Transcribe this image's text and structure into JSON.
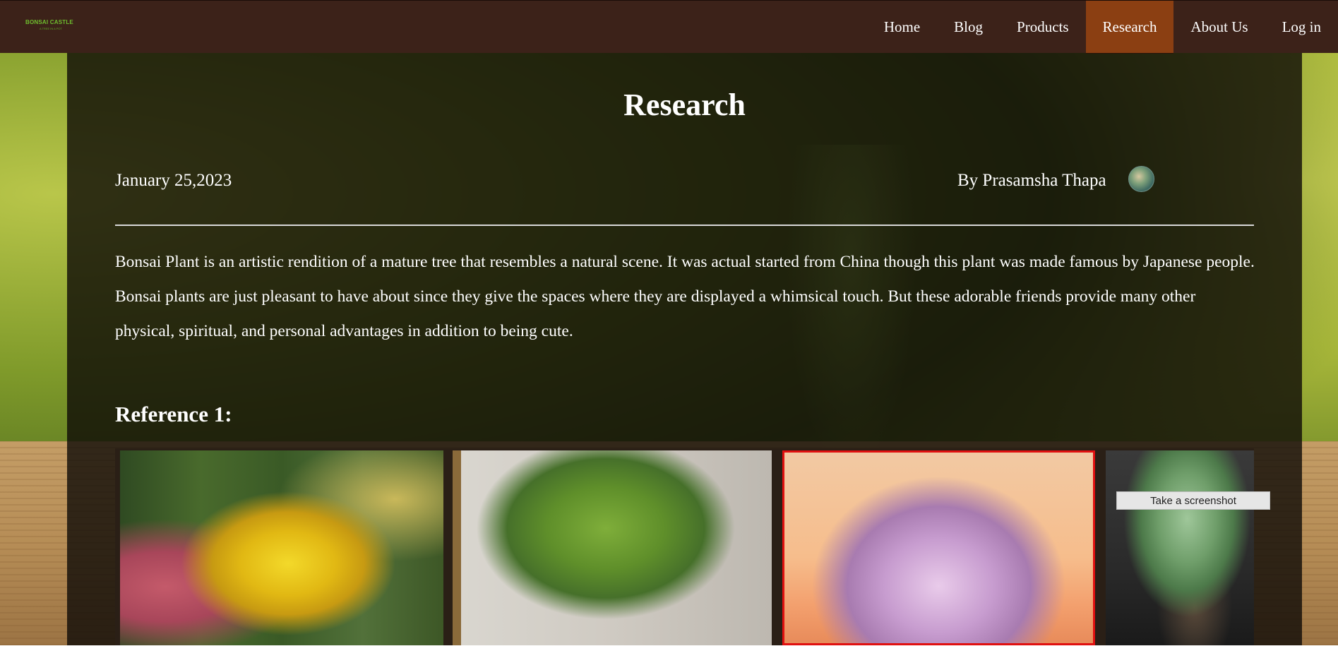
{
  "header": {
    "logo_text": "BONSAI  CASTLE",
    "logo_tagline": "A TREE IN A POT"
  },
  "nav": {
    "items": [
      {
        "label": "Home"
      },
      {
        "label": "Blog"
      },
      {
        "label": "Products"
      },
      {
        "label": "Research",
        "active": true
      },
      {
        "label": "About Us"
      },
      {
        "label": "Log in"
      }
    ]
  },
  "article": {
    "title": "Research",
    "date": "January 25,2023",
    "author": "By Prasamsha Thapa",
    "intro": "Bonsai Plant is an artistic rendition of a mature tree that resembles a natural scene. It was actual started from China though this plant was made famous by Japanese people. Bonsai plants are just pleasant to have about since they give the spaces where they are displayed a whimsical touch. But these adorable friends provide many other physical, spiritual, and personal advantages in addition to being cute.",
    "reference_heading": "Reference 1:"
  },
  "tooltip": {
    "label": "Take a screenshot"
  },
  "colors": {
    "navbar": "#3c2219",
    "nav_active": "#8b3f12",
    "selection_border": "#e01010"
  }
}
